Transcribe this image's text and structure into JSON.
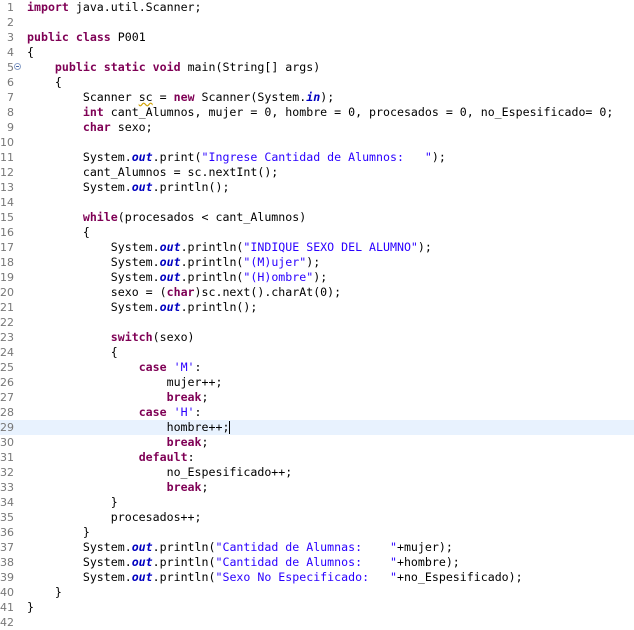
{
  "editor": {
    "language": "java",
    "current_line": 29,
    "fold_marker_line": 5,
    "lines": [
      {
        "n": "1",
        "tokens": [
          [
            "kw",
            "import"
          ],
          [
            "",
            " java.util.Scanner;"
          ]
        ]
      },
      {
        "n": "2",
        "tokens": []
      },
      {
        "n": "3",
        "tokens": [
          [
            "kw",
            "public"
          ],
          [
            "",
            " "
          ],
          [
            "kw",
            "class"
          ],
          [
            "",
            " P001"
          ]
        ]
      },
      {
        "n": "4",
        "tokens": [
          [
            "",
            "{"
          ]
        ]
      },
      {
        "n": "5",
        "tokens": [
          [
            "",
            "    "
          ],
          [
            "kw",
            "public"
          ],
          [
            "",
            " "
          ],
          [
            "kw",
            "static"
          ],
          [
            "",
            " "
          ],
          [
            "kw",
            "void"
          ],
          [
            "",
            " main(String[] args)"
          ]
        ]
      },
      {
        "n": "6",
        "tokens": [
          [
            "",
            "    {"
          ]
        ]
      },
      {
        "n": "7",
        "tokens": [
          [
            "",
            "        Scanner "
          ],
          [
            "warn",
            "sc"
          ],
          [
            "",
            " = "
          ],
          [
            "kw",
            "new"
          ],
          [
            "",
            " Scanner(System."
          ],
          [
            "fld",
            "in"
          ],
          [
            "",
            ");"
          ]
        ]
      },
      {
        "n": "8",
        "tokens": [
          [
            "",
            "        "
          ],
          [
            "kw",
            "int"
          ],
          [
            "",
            " cant_Alumnos, mujer = 0, hombre = 0, procesados = 0, no_Espesificado= 0;"
          ]
        ]
      },
      {
        "n": "9",
        "tokens": [
          [
            "",
            "        "
          ],
          [
            "kw",
            "char"
          ],
          [
            "",
            " sexo;"
          ]
        ]
      },
      {
        "n": "10",
        "tokens": []
      },
      {
        "n": "11",
        "tokens": [
          [
            "",
            "        System."
          ],
          [
            "fld",
            "out"
          ],
          [
            "",
            ".print("
          ],
          [
            "str",
            "\"Ingrese Cantidad de Alumnos:   \""
          ],
          [
            "",
            ");"
          ]
        ]
      },
      {
        "n": "12",
        "tokens": [
          [
            "",
            "        cant_Alumnos = sc.nextInt();"
          ]
        ]
      },
      {
        "n": "13",
        "tokens": [
          [
            "",
            "        System."
          ],
          [
            "fld",
            "out"
          ],
          [
            "",
            ".println();"
          ]
        ]
      },
      {
        "n": "14",
        "tokens": []
      },
      {
        "n": "15",
        "tokens": [
          [
            "",
            "        "
          ],
          [
            "kw",
            "while"
          ],
          [
            "",
            "(procesados < cant_Alumnos)"
          ]
        ]
      },
      {
        "n": "16",
        "tokens": [
          [
            "",
            "        {"
          ]
        ]
      },
      {
        "n": "17",
        "tokens": [
          [
            "",
            "            System."
          ],
          [
            "fld",
            "out"
          ],
          [
            "",
            ".println("
          ],
          [
            "str",
            "\"INDIQUE SEXO DEL ALUMNO\""
          ],
          [
            "",
            ");"
          ]
        ]
      },
      {
        "n": "18",
        "tokens": [
          [
            "",
            "            System."
          ],
          [
            "fld",
            "out"
          ],
          [
            "",
            ".println("
          ],
          [
            "str",
            "\"(M)ujer\""
          ],
          [
            "",
            ");"
          ]
        ]
      },
      {
        "n": "19",
        "tokens": [
          [
            "",
            "            System."
          ],
          [
            "fld",
            "out"
          ],
          [
            "",
            ".println("
          ],
          [
            "str",
            "\"(H)ombre\""
          ],
          [
            "",
            ");"
          ]
        ]
      },
      {
        "n": "20",
        "tokens": [
          [
            "",
            "            sexo = ("
          ],
          [
            "kw",
            "char"
          ],
          [
            "",
            ")sc.next().charAt(0);"
          ]
        ]
      },
      {
        "n": "21",
        "tokens": [
          [
            "",
            "            System."
          ],
          [
            "fld",
            "out"
          ],
          [
            "",
            ".println();"
          ]
        ]
      },
      {
        "n": "22",
        "tokens": []
      },
      {
        "n": "23",
        "tokens": [
          [
            "",
            "            "
          ],
          [
            "kw",
            "switch"
          ],
          [
            "",
            "(sexo)"
          ]
        ]
      },
      {
        "n": "24",
        "tokens": [
          [
            "",
            "            {"
          ]
        ]
      },
      {
        "n": "25",
        "tokens": [
          [
            "",
            "                "
          ],
          [
            "kw",
            "case"
          ],
          [
            "",
            " "
          ],
          [
            "str",
            "'M'"
          ],
          [
            "",
            ":"
          ]
        ]
      },
      {
        "n": "26",
        "tokens": [
          [
            "",
            "                    mujer++;"
          ]
        ]
      },
      {
        "n": "27",
        "tokens": [
          [
            "",
            "                    "
          ],
          [
            "kw",
            "break"
          ],
          [
            "",
            ";"
          ]
        ]
      },
      {
        "n": "28",
        "tokens": [
          [
            "",
            "                "
          ],
          [
            "kw",
            "case"
          ],
          [
            "",
            " "
          ],
          [
            "str",
            "'H'"
          ],
          [
            "",
            ":"
          ]
        ]
      },
      {
        "n": "29",
        "tokens": [
          [
            "",
            "                    hombre++;"
          ],
          [
            "caret",
            ""
          ]
        ]
      },
      {
        "n": "30",
        "tokens": [
          [
            "",
            "                    "
          ],
          [
            "kw",
            "break"
          ],
          [
            "",
            ";"
          ]
        ]
      },
      {
        "n": "31",
        "tokens": [
          [
            "",
            "                "
          ],
          [
            "kw",
            "default"
          ],
          [
            "",
            ":"
          ]
        ]
      },
      {
        "n": "32",
        "tokens": [
          [
            "",
            "                    no_Espesificado++;"
          ]
        ]
      },
      {
        "n": "33",
        "tokens": [
          [
            "",
            "                    "
          ],
          [
            "kw",
            "break"
          ],
          [
            "",
            ";"
          ]
        ]
      },
      {
        "n": "34",
        "tokens": [
          [
            "",
            "            }"
          ]
        ]
      },
      {
        "n": "35",
        "tokens": [
          [
            "",
            "            procesados++;"
          ]
        ]
      },
      {
        "n": "36",
        "tokens": [
          [
            "",
            "        }"
          ]
        ]
      },
      {
        "n": "37",
        "tokens": [
          [
            "",
            "        System."
          ],
          [
            "fld",
            "out"
          ],
          [
            "",
            ".println("
          ],
          [
            "str",
            "\"Cantidad de Alumnas:    \""
          ],
          [
            "",
            "+mujer);"
          ]
        ]
      },
      {
        "n": "38",
        "tokens": [
          [
            "",
            "        System."
          ],
          [
            "fld",
            "out"
          ],
          [
            "",
            ".println("
          ],
          [
            "str",
            "\"Cantidad de Alumnos:    \""
          ],
          [
            "",
            "+hombre);"
          ]
        ]
      },
      {
        "n": "39",
        "tokens": [
          [
            "",
            "        System."
          ],
          [
            "fld",
            "out"
          ],
          [
            "",
            ".println("
          ],
          [
            "str",
            "\"Sexo No Especificado:   \""
          ],
          [
            "",
            "+no_Espesificado);"
          ]
        ]
      },
      {
        "n": "40",
        "tokens": [
          [
            "",
            "    }"
          ]
        ]
      },
      {
        "n": "41",
        "tokens": [
          [
            "",
            "}"
          ]
        ]
      },
      {
        "n": "42",
        "tokens": []
      }
    ]
  },
  "colors": {
    "keyword": "#7f0055",
    "string": "#2a00ff",
    "field": "#0000c0",
    "line_number": "#787878",
    "current_line_bg": "#e8f2fe"
  }
}
